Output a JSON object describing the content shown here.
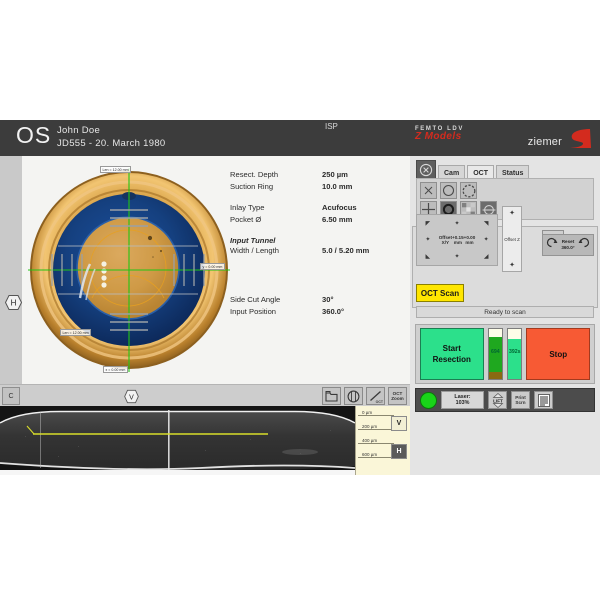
{
  "header": {
    "eye_label": "OS",
    "patient_name": "John Doe",
    "patient_id_dob": "JD555  -  20. March 1980",
    "mode": "ISP",
    "brand_line1": "FEMTO LDV",
    "brand_line2": "Z Models",
    "company": "ziemer",
    "accent_red": "#d32b1e"
  },
  "image_view": {
    "label_top": "Len = 12.00 mm",
    "label_left": "Len = 12.00 mm",
    "label_right": "y = 0.00 mm",
    "label_bottom": "x = 0.00 mm",
    "side_badge": "H",
    "corner_button": "C",
    "center_badge": "V",
    "tool_oct_label": "OCT",
    "tool_octzoom_line1": "OCT",
    "tool_octzoom_line2": "Zoom"
  },
  "parameters": {
    "group1": [
      {
        "key": "Resect. Depth",
        "value": "250 µm"
      },
      {
        "key": "Suction Ring",
        "value": "10.0 mm"
      }
    ],
    "group2": [
      {
        "key": "Inlay Type",
        "value": "Acufocus"
      },
      {
        "key": "Pocket Ø",
        "value": "6.50 mm"
      }
    ],
    "group3_title": "Input Tunnel",
    "group3": [
      {
        "key": "Width / Length",
        "value": "5.0 / 5.20 mm"
      }
    ],
    "group4": [
      {
        "key": "Side Cut Angle",
        "value": "30°"
      },
      {
        "key": "Input Position",
        "value": "360.0°"
      }
    ]
  },
  "oct_scale": {
    "ticks": [
      "0 µm",
      "200 µm",
      "400 µm",
      "600 µm"
    ],
    "vertical_button": "V",
    "horizontal_button": "H"
  },
  "right_panel": {
    "tabs": [
      {
        "label": "Cam",
        "active": false
      },
      {
        "label": "OCT",
        "active": true
      },
      {
        "label": "Status",
        "active": false
      }
    ],
    "offset_xy_title": "Offset X/Y",
    "offset_x": "+0.15 mm",
    "offset_y": "+0.00 mm",
    "offset_z_label": "Offset Z",
    "reset_label": "Reset",
    "reset_value": "360.0°",
    "oct_scan_button": "OCT Scan",
    "scan_status": "Ready to scan",
    "start_button_line1": "Start",
    "start_button_line2": "Resection",
    "stop_button": "Stop",
    "gauge_left_value": "694",
    "gauge_right_value": "392s",
    "laser_label": "Laser:",
    "laser_value": "103%",
    "lift_button": "LIFT",
    "print_line1": "Print",
    "print_line2": "Scrn",
    "colors": {
      "start_green": "#2ce08b",
      "stop_red": "#f75a34",
      "scan_yellow": "#ffe600",
      "led_green": "#19d419"
    }
  }
}
